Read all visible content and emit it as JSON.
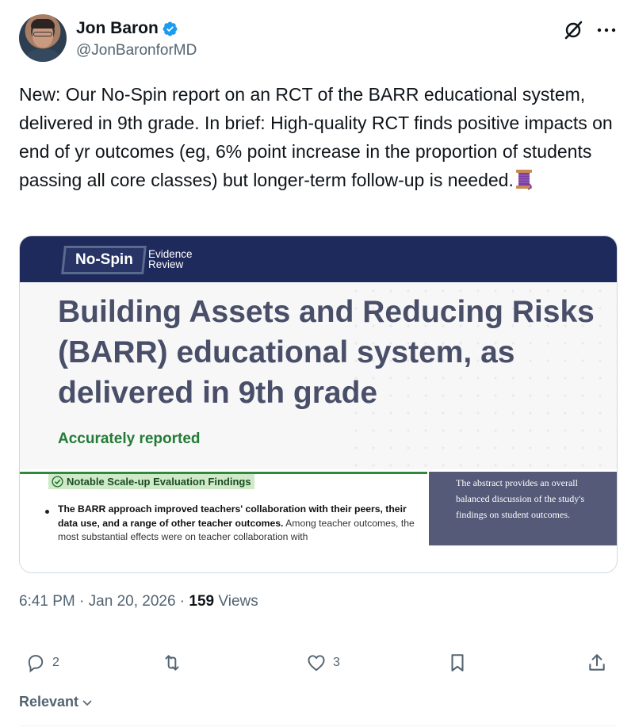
{
  "author": {
    "display_name": "Jon Baron",
    "handle": "@JonBaronforMD"
  },
  "tweet": {
    "text": "New: Our No-Spin report on an RCT of the BARR educational system, delivered in 9th grade. In brief: High-quality RCT finds positive impacts on end of yr outcomes (eg, 6% point increase in the proportion of students passing all core classes) but longer-term follow-up is needed.",
    "emoji_icon": "thread-spool-icon"
  },
  "card": {
    "badge": "No-Spin",
    "badge_sub_1": "Evidence",
    "badge_sub_2": "Review",
    "title": "Building Assets and Reducing Risks (BARR) educational system, as delivered in 9th grade",
    "verdict": "Accurately reported",
    "findings_label": "Notable Scale-up Evaluation Findings",
    "bullet_bold": "The BARR approach improved teachers' collaboration with their peers, their data use, and a range of other teacher outcomes.",
    "bullet_rest": " Among teacher outcomes, the most substantial effects were on teacher collaboration with",
    "side_text": "The abstract provides an overall balanced discussion of the study's findings on student outcomes.",
    "colors": {
      "header_bg": "#1f2a5c",
      "title": "#4a4f69",
      "verdict": "#237b35",
      "side_bg": "#545a78"
    }
  },
  "meta": {
    "time": "6:41 PM",
    "sep1": " · ",
    "date": "Jan 20, 2026",
    "sep2": " · ",
    "views_count": "159",
    "views_label": " Views"
  },
  "actions": {
    "replies": "2",
    "retweets": "",
    "likes": "3"
  },
  "sort": {
    "label": "Relevant"
  },
  "colors": {
    "text": "#0f1419",
    "muted": "#536471",
    "verified": "#1d9bf0"
  }
}
